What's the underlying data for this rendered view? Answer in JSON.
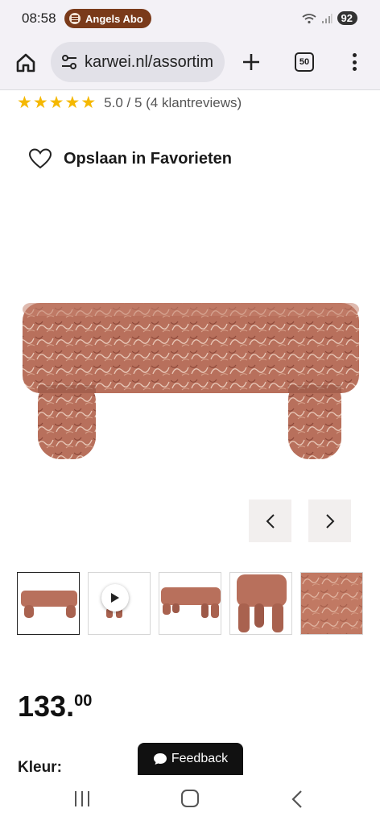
{
  "status_bar": {
    "time": "08:58",
    "media_text": "Angels Abo",
    "battery": "92"
  },
  "browser": {
    "url": "karwei.nl/assortim",
    "tab_count": "50",
    "icons": [
      "home-icon",
      "tune-icon",
      "plus-icon",
      "tabs-icon",
      "more-vert-icon"
    ]
  },
  "product": {
    "rating_stars": 5,
    "rating_text": "5.0 / 5 (4 klantreviews)",
    "favorite_label": "Opslaan in Favorieten",
    "price_whole": "133.",
    "price_cents": "00",
    "color_label": "Kleur:",
    "thumbnail_count": 5,
    "accent_color": "#f5b800"
  },
  "feedback": {
    "label": "Feedback"
  }
}
